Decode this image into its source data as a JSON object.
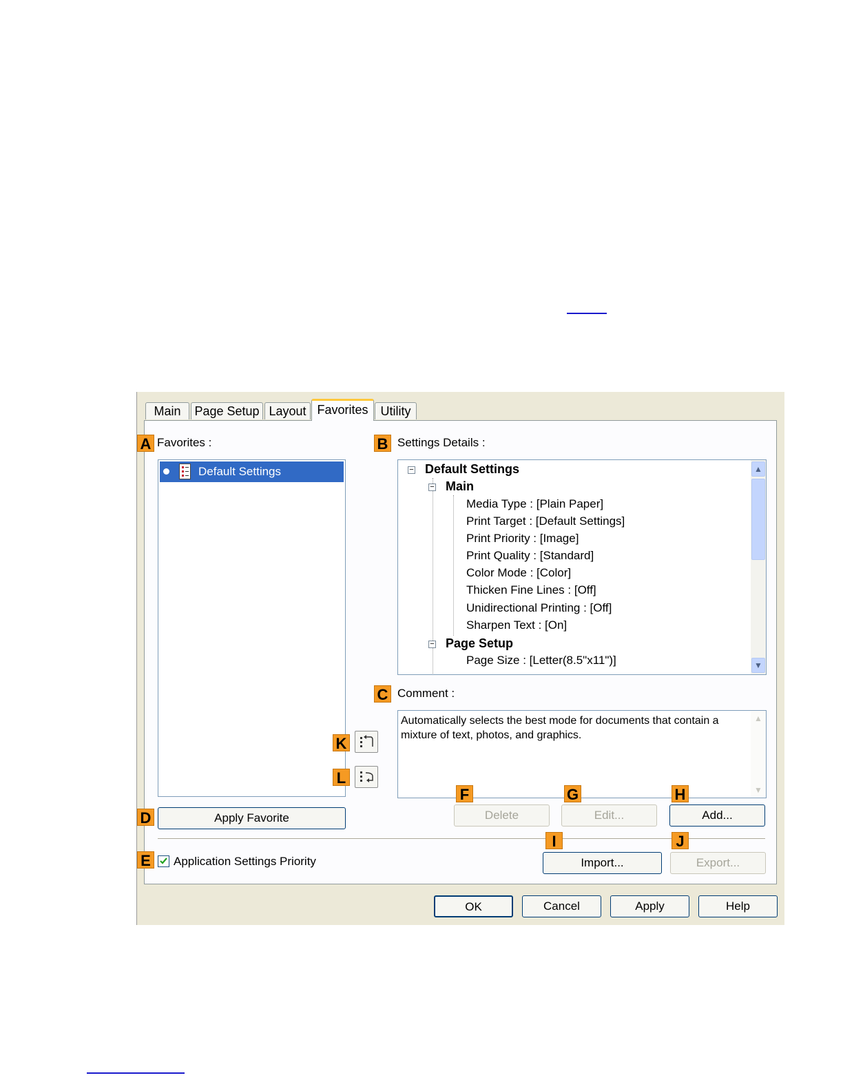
{
  "tabs": [
    {
      "label": "Main"
    },
    {
      "label": "Page Setup"
    },
    {
      "label": "Layout"
    },
    {
      "label": "Favorites",
      "active": true
    },
    {
      "label": "Utility"
    }
  ],
  "favorites": {
    "badge": "A",
    "label": "Favorites :",
    "items": [
      {
        "label": "Default Settings",
        "selected": true
      }
    ],
    "apply_badge": "D",
    "apply_label": "Apply Favorite"
  },
  "settings_details": {
    "badge": "B",
    "label": "Settings Details :",
    "root": "Default Settings",
    "groups": [
      {
        "name": "Main",
        "items": [
          "Media Type : [Plain Paper]",
          "Print Target : [Default Settings]",
          "Print Priority : [Image]",
          "Print Quality : [Standard]",
          "Color Mode : [Color]",
          "Thicken Fine Lines : [Off]",
          "Unidirectional Printing : [Off]",
          "Sharpen Text : [On]"
        ]
      },
      {
        "name": "Page Setup",
        "items": [
          "Page Size : [Letter(8.5\"x11\")]"
        ]
      }
    ]
  },
  "comment": {
    "badge": "C",
    "label": "Comment :",
    "text": "Automatically selects the best mode for documents that contain a mixture of text, photos, and graphics."
  },
  "side_buttons": {
    "up_badge": "K",
    "down_badge": "L"
  },
  "actions": {
    "delete": {
      "badge": "F",
      "label": "Delete"
    },
    "edit": {
      "badge": "G",
      "label": "Edit..."
    },
    "add": {
      "badge": "H",
      "label": "Add..."
    },
    "import": {
      "badge": "I",
      "label": "Import..."
    },
    "export": {
      "badge": "J",
      "label": "Export..."
    }
  },
  "app_priority": {
    "badge": "E",
    "label": "Application Settings Priority",
    "checked": true
  },
  "footer": {
    "ok": "OK",
    "cancel": "Cancel",
    "apply": "Apply",
    "help": "Help"
  },
  "colors": {
    "accent_badge": "#f59a23",
    "selection": "#316ac5",
    "dialog_bg": "#ece9d8"
  }
}
